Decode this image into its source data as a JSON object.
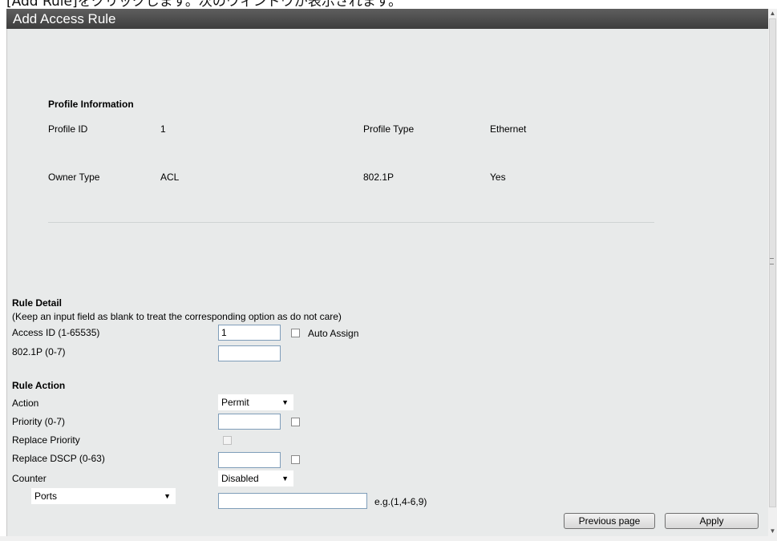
{
  "caption": "[Add Rule]をクリックします。次のウィンドウが表示されます。",
  "window": {
    "title": "Add Access Rule"
  },
  "profile": {
    "heading": "Profile Information",
    "id_label": "Profile ID",
    "id_value": "1",
    "type_label": "Profile Type",
    "type_value": "Ethernet",
    "owner_label": "Owner Type",
    "owner_value": "ACL",
    "p8021_label": "802.1P",
    "p8021_value": "Yes"
  },
  "rule_detail": {
    "heading": "Rule Detail",
    "note": "(Keep an input field as blank to treat the corresponding option as do not care)",
    "access_id_label": "Access ID (1-65535)",
    "access_id_value": "1",
    "auto_assign_label": "Auto Assign",
    "p8021_label": "802.1P  (0-7)",
    "p8021_value": ""
  },
  "rule_action": {
    "heading": "Rule Action",
    "action_label": "Action",
    "action_value": "Permit",
    "priority_label": "Priority  (0-7)",
    "priority_value": "",
    "replace_priority_label": "Replace Priority",
    "replace_dscp_label": "Replace DSCP  (0-63)",
    "replace_dscp_value": "",
    "counter_label": "Counter",
    "counter_value": "Disabled",
    "ports_select": "Ports",
    "ports_value": "",
    "ports_hint": "e.g.(1,4-6,9)"
  },
  "buttons": {
    "previous": "Previous page",
    "apply": "Apply"
  }
}
